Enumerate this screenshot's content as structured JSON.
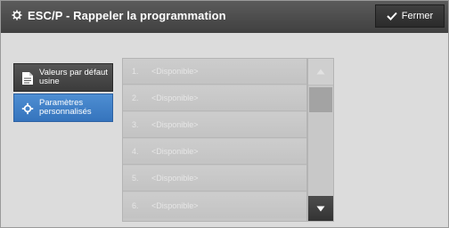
{
  "header": {
    "title": "ESC/P - Rappeler la programmation",
    "close_label": "Fermer"
  },
  "sidebar": {
    "items": [
      {
        "label": "Valeurs par défaut usine",
        "icon": "document-icon",
        "selected": false
      },
      {
        "label": "Paramètres personnalisés",
        "icon": "gear-icon",
        "selected": true
      }
    ]
  },
  "list": {
    "items": [
      {
        "number": "1.",
        "label": "<Disponible>"
      },
      {
        "number": "2.",
        "label": "<Disponible>"
      },
      {
        "number": "3.",
        "label": "<Disponible>"
      },
      {
        "number": "4.",
        "label": "<Disponible>"
      },
      {
        "number": "5.",
        "label": "<Disponible>"
      },
      {
        "number": "6.",
        "label": "<Disponible>"
      }
    ]
  },
  "colors": {
    "titlebar": "#4a4a4a",
    "selected": "#3f82c9",
    "background": "#dcdcdc"
  }
}
